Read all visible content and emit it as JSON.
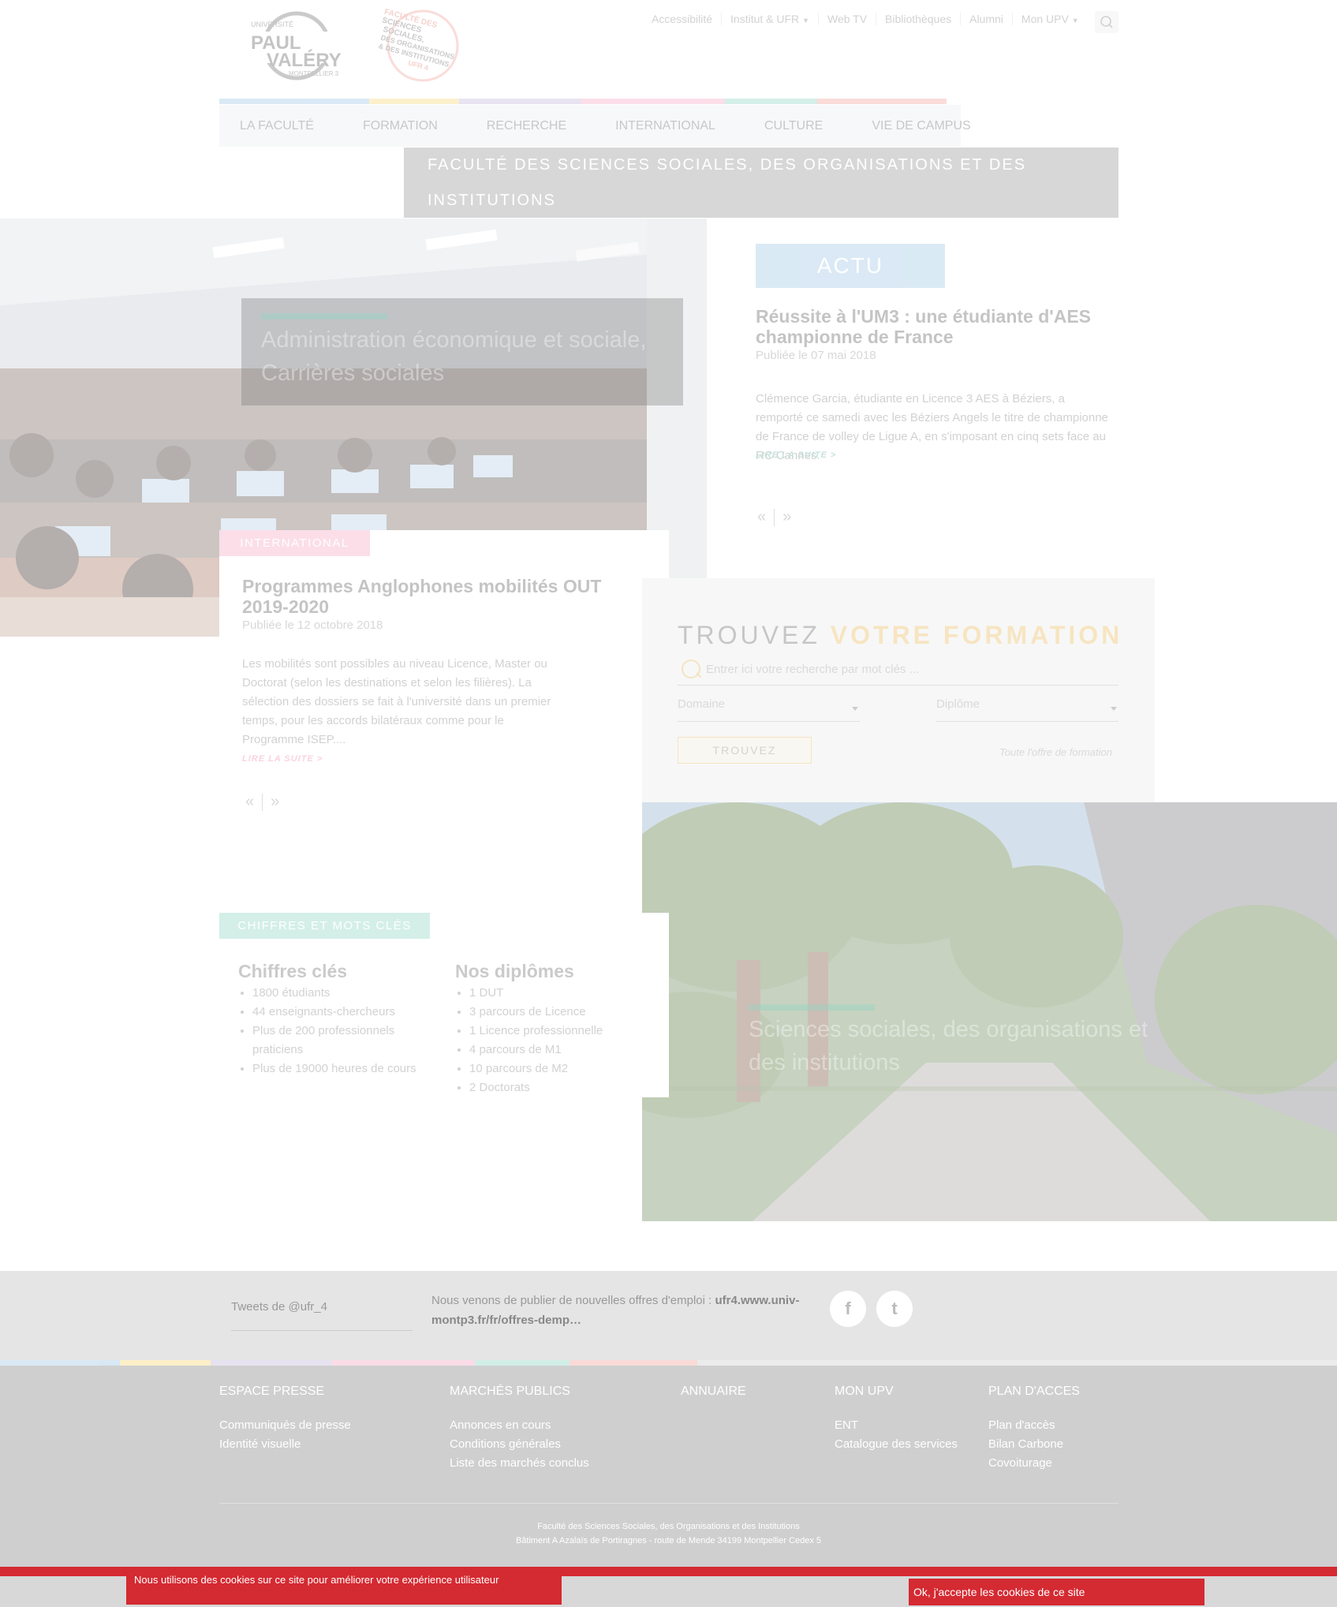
{
  "header": {
    "logo_upv": {
      "line1": "UNIVERSITÉ",
      "line2": "PAUL",
      "line3": "VALÉRY",
      "line4": "MONTPELLIER 3"
    },
    "logo_ufr": {
      "line1": "FACULTÉ DES",
      "line2": "SCIENCES",
      "line3": "SOCIALES,",
      "line4": "DES ORGANISATIONS",
      "line5": "& DES INSTITUTIONS",
      "line6": "UFR 4"
    },
    "top_links": [
      "Accessibilité",
      "Institut & UFR",
      "Web TV",
      "Bibliothèques",
      "Alumni",
      "Mon UPV"
    ],
    "nav": [
      "LA FACULTÉ",
      "FORMATION",
      "RECHERCHE",
      "INTERNATIONAL",
      "CULTURE",
      "VIE DE CAMPUS"
    ],
    "ufr_title": "FACULTÉ DES SCIENCES SOCIALES, DES ORGANISATIONS ET DES INSTITUTIONS"
  },
  "colors": {
    "bar": [
      "#9fc7e6",
      "#f8d97a",
      "#c3b8dc",
      "#f5a9c5",
      "#8fd6c4",
      "#f2a49c"
    ],
    "accent_teal": "#8fd6c4",
    "accent_yellow": "#f8c86a",
    "cookie_red": "#d42a32"
  },
  "hero1": {
    "title": "Administration économique et sociale, Carrières sociales"
  },
  "actu": {
    "badge": "ACTU",
    "title": "Réussite à l'UM3 : une étudiante d'AES championne de France",
    "date": "Publiée le 07 mai 2018",
    "text": "Clémence Garcia, étudiante en Licence 3 AES à Béziers, a remporté ce samedi avec les Béziers Angels le titre de championne de France de volley de Ligue A, en s'imposant en cinq sets face au RC Cannes.",
    "more": "LIRE LA SUITE >"
  },
  "pager": {
    "prev": "«",
    "next": "»"
  },
  "international": {
    "badge": "INTERNATIONAL",
    "title": "Programmes Anglophones mobilités OUT 2019-2020",
    "date": "Publiée le 12 octobre 2018",
    "text": "Les mobilités sont possibles au niveau Licence, Master ou Doctorat (selon les destinations et selon les filières). La sélection des dossiers se fait à l'université dans un premier temps, pour les accords bilatéraux comme pour le Programme ISEP....",
    "more": "LIRE LA SUITE >"
  },
  "trouvez": {
    "title_a": "TROUVEZ ",
    "title_b": "VOTRE FORMATION",
    "search_placeholder": "Entrer ici votre recherche par mot clés ...",
    "domaine": "Domaine",
    "diplome": "Diplôme",
    "button": "TROUVEZ",
    "all": "Toute l'offre de formation"
  },
  "hero2": {
    "title": "Sciences sociales, des organisations et des institutions"
  },
  "chiffres": {
    "badge": "CHIFFRES ET MOTS CLÉS",
    "col1_title": "Chiffres clés",
    "col1": [
      "1800 étudiants",
      "44 enseignants-chercheurs",
      "Plus de 200 professionnels praticiens",
      "Plus de 19000 heures de cours"
    ],
    "col2_title": "Nos diplômes",
    "col2": [
      "1 DUT",
      "3 parcours de Licence",
      "1 Licence professionnelle",
      "4 parcours de M1",
      "10 parcours de M2",
      "2 Doctorats"
    ]
  },
  "tweets": {
    "label": "Tweets de @ufr_4",
    "text_a": "Nous venons de publier de nouvelles offres d'emploi : ",
    "text_b": "ufr4.www.univ-montp3.fr/fr/offres-demp…",
    "facebook": "f",
    "twitter": "t"
  },
  "footer": {
    "cols": [
      {
        "title": "ESPACE PRESSE",
        "links": [
          "Communiqués de presse",
          "Identité visuelle"
        ]
      },
      {
        "title": "MARCHÉS PUBLICS",
        "links": [
          "Annonces en cours",
          "Conditions générales",
          "Liste des marchés conclus"
        ]
      },
      {
        "title": "ANNUAIRE",
        "links": []
      },
      {
        "title": "MON UPV",
        "links": [
          "ENT",
          "Catalogue des services"
        ]
      },
      {
        "title": "PLAN D'ACCES",
        "links": [
          "Plan d'accès",
          "Bilan Carbone",
          "Covoiturage"
        ]
      }
    ],
    "addr1": "Faculté des Sciences Sociales, des Organisations et des Institutions",
    "addr2": "Bâtiment A Azalaïs de Portiragnes - route de Mende  34199 Montpellier Cedex 5"
  },
  "cookie": {
    "text": "Nous utilisons des cookies sur ce site pour améliorer votre expérience utilisateur",
    "button": "Ok, j'accepte les cookies de ce site"
  }
}
